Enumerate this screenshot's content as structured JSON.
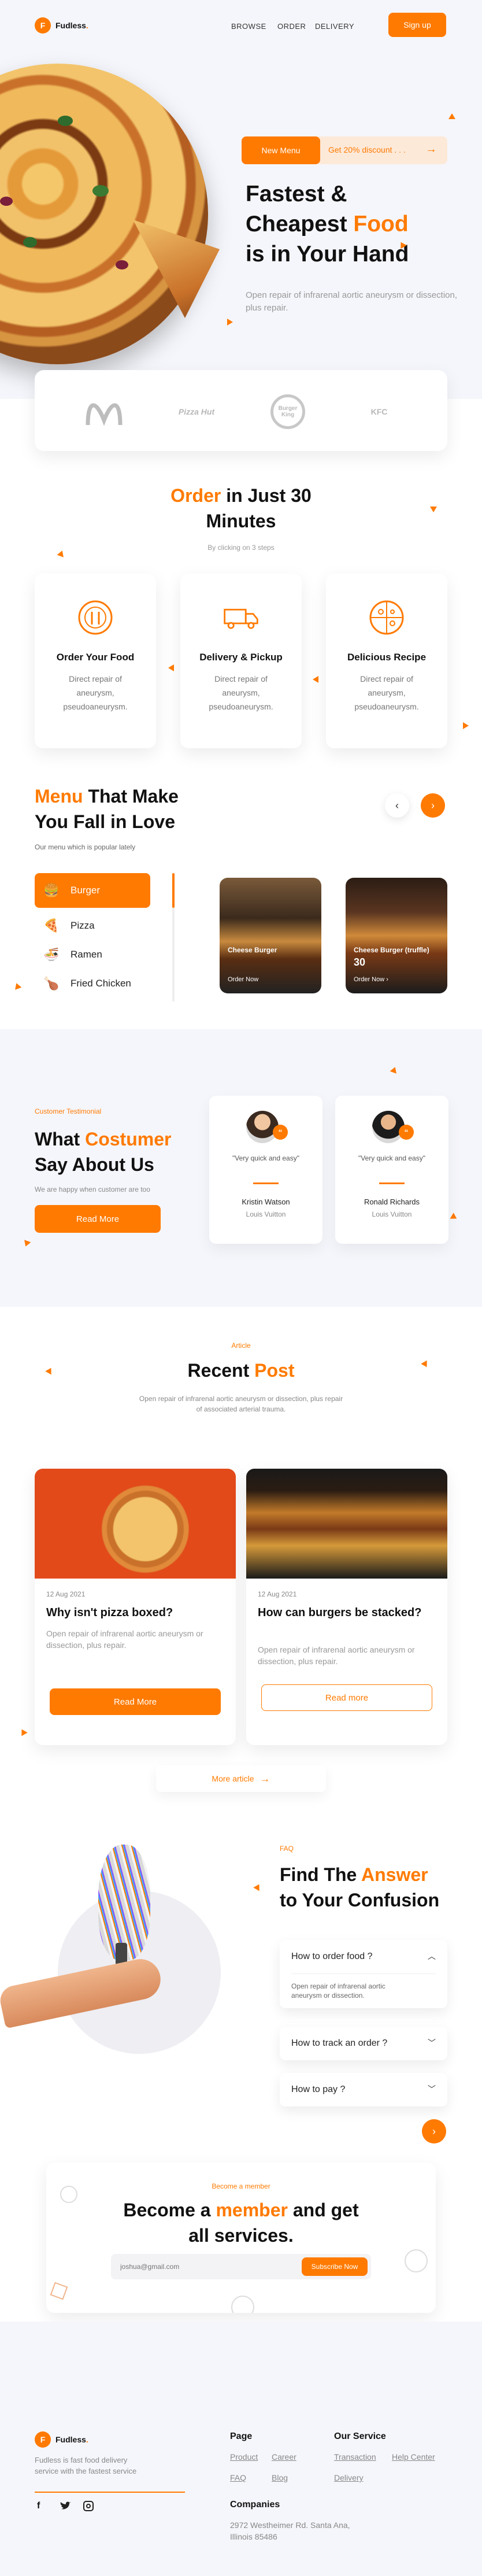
{
  "brand": {
    "logo_letter": "F",
    "name_main": "Fudless",
    "name_dot": "."
  },
  "nav": {
    "items": [
      "BROWSE",
      "ORDER",
      "DELIVERY"
    ],
    "signup": "Sign up"
  },
  "hero": {
    "pill_new": "New Menu",
    "pill_discount": "Get 20% discount . . .",
    "title_line1": "Fastest &",
    "title_line2a": "Cheapest ",
    "title_line2b": "Food",
    "title_line3": "is in Your Hand",
    "subtitle": "Open repair of infrarenal aortic aneurysm or dissection, plus repair."
  },
  "brands": [
    "McDonald's",
    "Pizza Hut",
    "Burger King",
    "KFC"
  ],
  "order": {
    "title_a": "Order",
    "title_b": " in Just 30",
    "title_c": "Minutes",
    "subtitle": "By clicking on 3 steps",
    "steps": [
      {
        "title": "Order Your Food",
        "desc": "Direct repair of aneurysm, pseudoaneurysm."
      },
      {
        "title": "Delivery & Pickup",
        "desc": "Direct repair of aneurysm, pseudoaneurysm."
      },
      {
        "title": "Delicious Recipe",
        "desc": "Direct repair of aneurysm, pseudoaneurysm."
      }
    ]
  },
  "menu": {
    "title_a": "Menu",
    "title_b": " That Make",
    "title_c": "You Fall in Love",
    "subtitle": "Our menu which is popular lately",
    "items": [
      "Burger",
      "Pizza",
      "Ramen",
      "Fried Chicken"
    ],
    "cards": [
      {
        "name": "Cheese Burger",
        "price": "",
        "action": "Order Now"
      },
      {
        "name": "Cheese Burger (truffle)",
        "price": "30",
        "action": "Order Now"
      }
    ]
  },
  "testimonial": {
    "eyebrow": "Customer Testimonial",
    "title_a": "What ",
    "title_b": "Costumer",
    "title_c": "Say About Us",
    "subtitle": "We are happy when customer are too",
    "cta": "Read More",
    "reviews": [
      {
        "quote": "\"Very quick and easy\"",
        "name": "Kristin Watson",
        "company": "Louis Vuitton"
      },
      {
        "quote": "\"Very quick and easy\"",
        "name": "Ronald Richards",
        "company": "Louis Vuitton"
      }
    ]
  },
  "blog": {
    "eyebrow": "Article",
    "title_a": "Recent ",
    "title_b": "Post",
    "subtitle": "Open repair of infrarenal aortic aneurysm or dissection, plus repair of associated arterial trauma.",
    "posts": [
      {
        "date": "12 Aug 2021",
        "title": "Why isn't pizza boxed?",
        "desc": "Open repair of infrarenal aortic aneurysm or dissection, plus repair.",
        "cta": "Read More"
      },
      {
        "date": "12 Aug 2021",
        "title": "How can burgers be stacked?",
        "desc": "Open repair of infrarenal aortic aneurysm or dissection, plus repair.",
        "cta": "Read more"
      }
    ],
    "more": "More article"
  },
  "faq": {
    "eyebrow": "FAQ",
    "title_a": "Find The ",
    "title_b": "Answer",
    "title_c": "to Your Confusion",
    "items": [
      {
        "q": "How to order food ?",
        "a": "Open repair of infrarenal aortic aneurysm or dissection."
      },
      {
        "q": "How to track an order ?",
        "a": ""
      },
      {
        "q": "How to pay ?",
        "a": ""
      }
    ]
  },
  "subscribe": {
    "eyebrow": "Become a member",
    "title_a": "Become a ",
    "title_b": "member",
    "title_c": " and get",
    "title_d": "all services.",
    "placeholder": "joshua@gmail.com",
    "button": "Subscribe Now"
  },
  "footer": {
    "desc": "Fudless is fast food delivery service with the fastest service",
    "page_head": "Page",
    "page_links": [
      "Product",
      "Career",
      "FAQ",
      "Blog"
    ],
    "service_head": "Our Service",
    "service_links": [
      "Transaction",
      "Help Center",
      "Delivery"
    ],
    "companies_head": "Companies",
    "address": "2972 Westheimer Rd. Santa Ana, Illinois 85486"
  },
  "colors": {
    "accent": "#ff7a00",
    "bg_soft": "#f5f6fb"
  }
}
